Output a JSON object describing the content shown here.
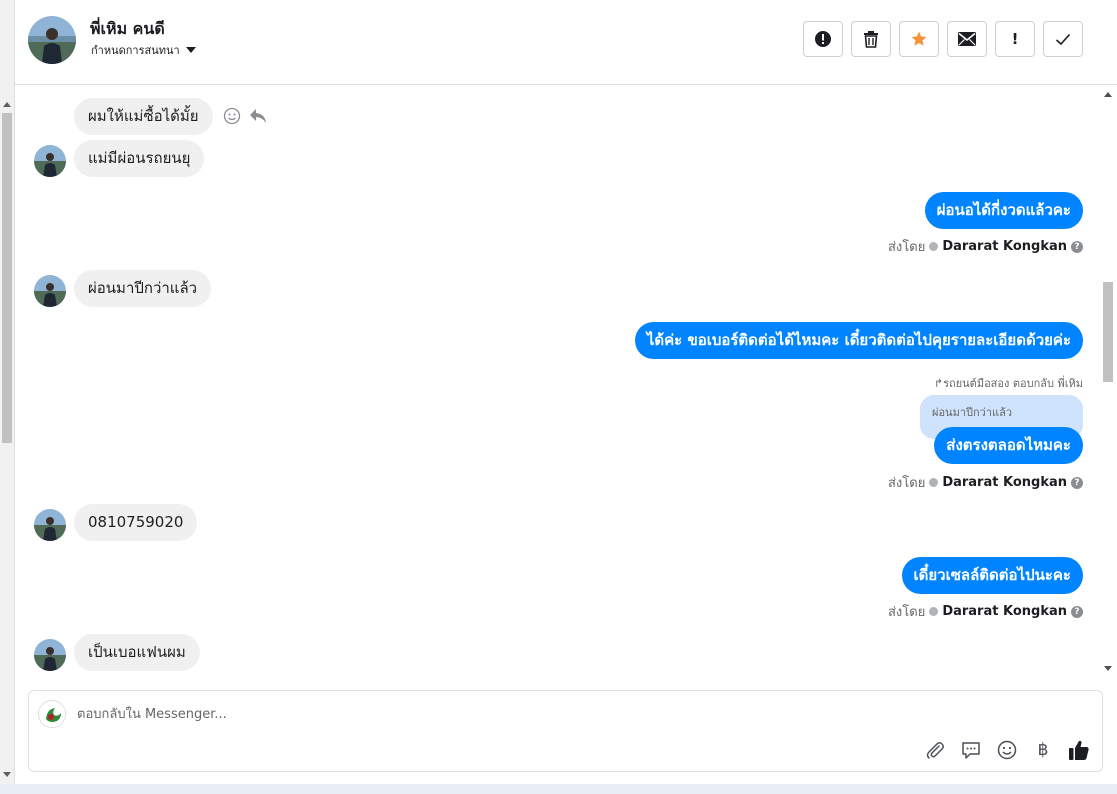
{
  "header": {
    "contact_name": "พี่เหิม คนดี",
    "assign_label": "กำหนดการสนทนา",
    "actions": {
      "spam": "!",
      "delete": "delete",
      "star": "star",
      "unread": "mail",
      "follow_up": "!",
      "done": "check"
    }
  },
  "messages": {
    "m1": "ผมให้แม่ซื้อได้มั้ย",
    "m2": "แม่มีผ่อนรถยนยุ",
    "m3": "ผ่อนอได้กี่งวดแล้วคะ",
    "m4": "ผ่อนมาปีกว่าแล้ว",
    "m5": "ได้ค่ะ ขอเบอร์ติดต่อได้ไหมคะ เดี๋ยวติดต่อไปคุยรายละเอียดด้วยค่ะ",
    "m6_reply_note": "↱รถยนต์มือสอง ตอบกลับ พี่เหิม",
    "m6_quoted": "ผ่อนมาปีกว่าแล้ว",
    "m6": "ส่งตรงตลอดไหมคะ",
    "m7": "0810759020",
    "m8": "เดี๋ยวเซลล์ติดต่อไปนะคะ",
    "m9": "เป็นเบอแฟนผม"
  },
  "sent_by": {
    "prefix": "ส่งโดย",
    "sender": "Dararat Kongkan"
  },
  "composer": {
    "placeholder": "ตอบกลับใน Messenger...",
    "currency_symbol": "฿"
  },
  "colors": {
    "outgoing_bubble": "#0084ff",
    "incoming_bubble": "#f0f0f0",
    "star": "#f7923b"
  }
}
